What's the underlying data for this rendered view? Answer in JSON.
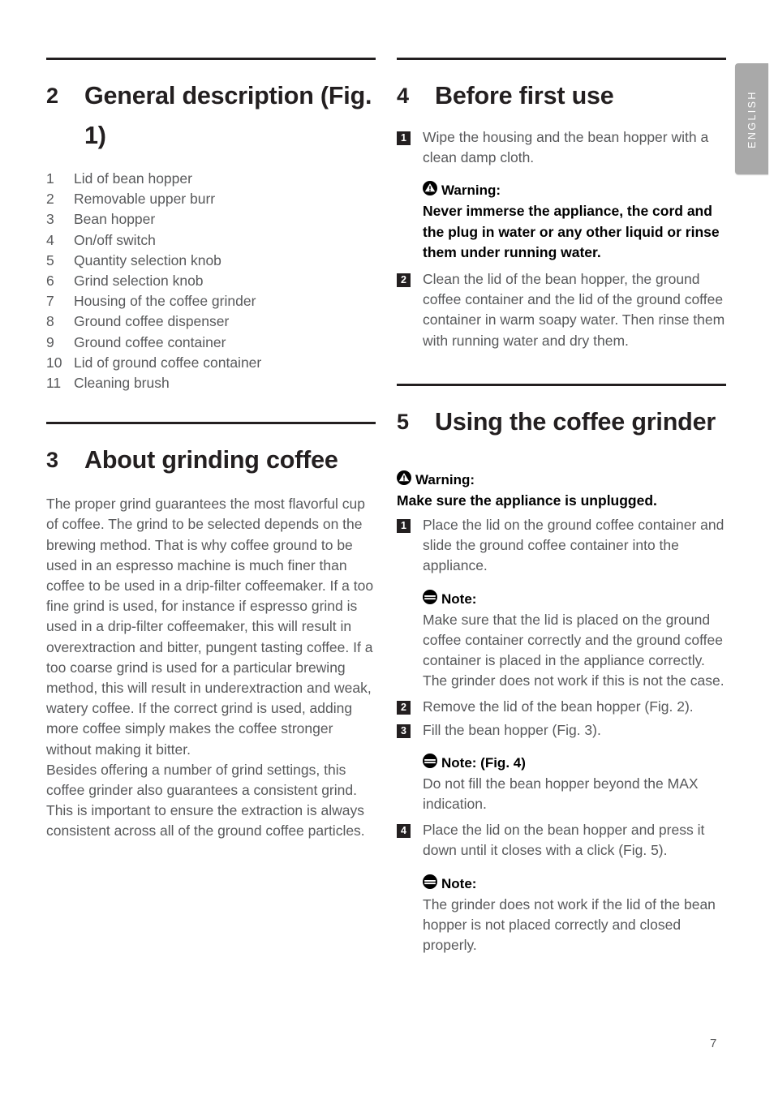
{
  "document": {
    "page_number": "7",
    "language_tab": "ENGLISH"
  },
  "colors": {
    "body_text": "#58595b",
    "heading_text": "#231f20",
    "callout_text": "#000000",
    "tab_background": "#a9a9a9",
    "rule": "#231f20",
    "marker_background": "#231f20",
    "marker_text": "#ffffff"
  },
  "left_column": {
    "section_general": {
      "number": "2",
      "title": "General description (Fig. 1)",
      "parts": [
        {
          "number": "1",
          "label": "Lid of bean hopper"
        },
        {
          "number": "2",
          "label": "Removable upper burr"
        },
        {
          "number": "3",
          "label": "Bean hopper"
        },
        {
          "number": "4",
          "label": "On/off switch"
        },
        {
          "number": "5",
          "label": "Quantity selection knob"
        },
        {
          "number": "6",
          "label": "Grind selection knob"
        },
        {
          "number": "7",
          "label": "Housing of the coffee grinder"
        },
        {
          "number": "8",
          "label": "Ground coffee dispenser"
        },
        {
          "number": "9",
          "label": "Ground coffee container"
        },
        {
          "number": "10",
          "label": "Lid of ground coffee container"
        },
        {
          "number": "11",
          "label": "Cleaning brush"
        }
      ]
    },
    "section_grinding": {
      "number": "3",
      "title": "About grinding coffee",
      "paragraph_1": "The proper grind guarantees the most flavorful cup of coffee. The grind to be selected depends on the brewing method. That is why coffee ground to be used in an espresso machine is much finer than coffee to be used in a drip-filter coffeemaker. If a too fine grind is used, for instance if espresso grind is used in a drip-filter coffeemaker, this will result in overextraction and bitter, pungent tasting coffee. If a too coarse grind is used for a particular brewing method, this will result in underextraction and weak, watery coffee. If the correct grind is used, adding more coffee simply makes the coffee stronger without making it bitter.",
      "paragraph_2": "Besides offering a number of grind settings, this coffee grinder also guarantees a consistent grind. This is important to ensure the extraction is always consistent across all of the ground coffee particles."
    }
  },
  "right_column": {
    "section_before_first_use": {
      "number": "4",
      "title": "Before first use",
      "step_1": {
        "marker": "1",
        "text": "Wipe the housing and the bean hopper with a clean damp cloth."
      },
      "warning": {
        "icon": "warning-icon",
        "heading": "Warning:",
        "text": "Never immerse the appliance, the cord and the plug in water or any other liquid or rinse them under running water."
      },
      "step_2": {
        "marker": "2",
        "text": "Clean the lid of the bean hopper, the ground coffee container and the lid of the ground coffee container in warm soapy water. Then rinse them with running water and dry them."
      }
    },
    "section_using_grinder": {
      "number": "5",
      "title": "Using the coffee grinder",
      "warning": {
        "icon": "warning-icon",
        "heading": "Warning:",
        "text": "Make sure the appliance is unplugged."
      },
      "step_1": {
        "marker": "1",
        "text": "Place the lid on the ground coffee container and slide the ground coffee container into the appliance."
      },
      "note_1": {
        "icon": "note-icon",
        "heading": "Note:",
        "text": "Make sure that the lid is placed on the ground coffee container correctly and the ground coffee container is placed in the appliance correctly. The grinder does not work if this is not the case."
      },
      "step_2": {
        "marker": "2",
        "text": "Remove the lid of the bean hopper (Fig. 2)."
      },
      "step_3": {
        "marker": "3",
        "text": "Fill the bean hopper (Fig. 3)."
      },
      "note_2": {
        "icon": "note-icon",
        "heading": "Note: (Fig. 4)",
        "text": "Do not fill the bean hopper beyond the MAX indication."
      },
      "step_4": {
        "marker": "4",
        "text": "Place the lid on the bean hopper and press it down until it closes with a click (Fig. 5)."
      },
      "note_3": {
        "icon": "note-icon",
        "heading": "Note:",
        "text": "The grinder does not work if the lid of the bean hopper is not placed correctly and closed properly."
      }
    }
  }
}
